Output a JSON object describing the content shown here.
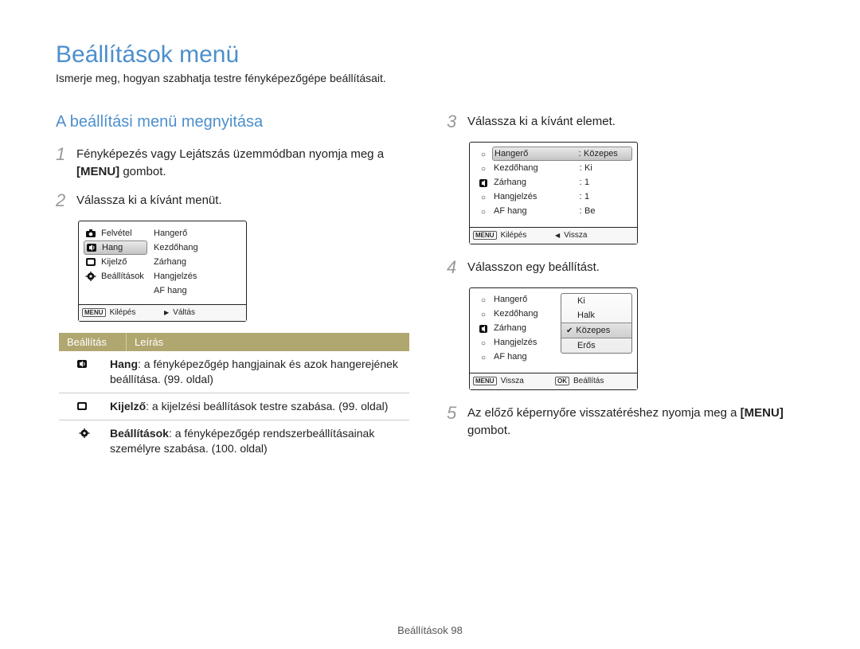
{
  "title": "Beállítások menü",
  "subtitle": "Ismerje meg, hogyan szabhatja testre fényképezőgépe beállításait.",
  "section_heading": "A beállítási menü megnyitása",
  "steps": {
    "s1": {
      "num": "1",
      "text_a": "Fényképezés vagy Lejátszás üzemmódban nyomja meg a",
      "text_b": " gombot.",
      "menu_label": "[MENU]"
    },
    "s2": {
      "num": "2",
      "text": "Válassza ki a kívánt menüt."
    },
    "s3": {
      "num": "3",
      "text": "Válassza ki a kívánt elemet."
    },
    "s4": {
      "num": "4",
      "text": "Válasszon egy beállítást."
    },
    "s5": {
      "num": "5",
      "text_a": "Az előző képernyőre visszatéréshez nyomja meg a",
      "text_b": " gombot.",
      "menu_label": "[MENU]"
    }
  },
  "lcd1": {
    "left_items": [
      {
        "icon": "camera",
        "label": "Felvétel",
        "selected": false
      },
      {
        "icon": "sound",
        "label": "Hang",
        "selected": true
      },
      {
        "icon": "display",
        "label": "Kijelző",
        "selected": false
      },
      {
        "icon": "gear",
        "label": "Beállítások",
        "selected": false
      }
    ],
    "right_items": [
      "Hangerő",
      "Kezdőhang",
      "Zárhang",
      "Hangjelzés",
      "AF hang"
    ],
    "footer": {
      "menu": "MENU",
      "left": "Kilépés",
      "right_glyph": "▶",
      "right": "Váltás"
    }
  },
  "lcd2": {
    "rows": [
      {
        "key": "Hangerő",
        "val": "Közepes",
        "selected": true
      },
      {
        "key": "Kezdőhang",
        "val": "Ki",
        "selected": false
      },
      {
        "key": "Zárhang",
        "val": "1",
        "selected": false
      },
      {
        "key": "Hangjelzés",
        "val": "1",
        "selected": false
      },
      {
        "key": "AF hang",
        "val": "Be",
        "selected": false
      }
    ],
    "footer": {
      "menu": "MENU",
      "left": "Kilépés",
      "right_glyph": "◀",
      "right": "Vissza"
    }
  },
  "lcd3": {
    "rows": [
      "Hangerő",
      "Kezdőhang",
      "Zárhang",
      "Hangjelzés",
      "AF hang"
    ],
    "popup": [
      {
        "label": "Ki",
        "selected": false
      },
      {
        "label": "Halk",
        "selected": false
      },
      {
        "label": "Közepes",
        "selected": true
      },
      {
        "label": "Erős",
        "selected": false
      }
    ],
    "footer": {
      "menu": "MENU",
      "left": "Vissza",
      "ok": "OK",
      "right": "Beállítás"
    }
  },
  "desc_table": {
    "headers": {
      "col1": "Beállítás",
      "col2": "Leírás"
    },
    "rows": [
      {
        "icon": "sound",
        "bold": "Hang",
        "rest": ": a fényképezőgép hangjainak és azok hangerejének beállítása. (99. oldal)"
      },
      {
        "icon": "display",
        "bold": "Kijelző",
        "rest": ": a kijelzési beállítások testre szabása. (99. oldal)"
      },
      {
        "icon": "gear",
        "bold": "Beállítások",
        "rest": ": a fényképezőgép rendszerbeállításainak személyre szabása. (100. oldal)"
      }
    ]
  },
  "footer_text": "Beállítások  98"
}
